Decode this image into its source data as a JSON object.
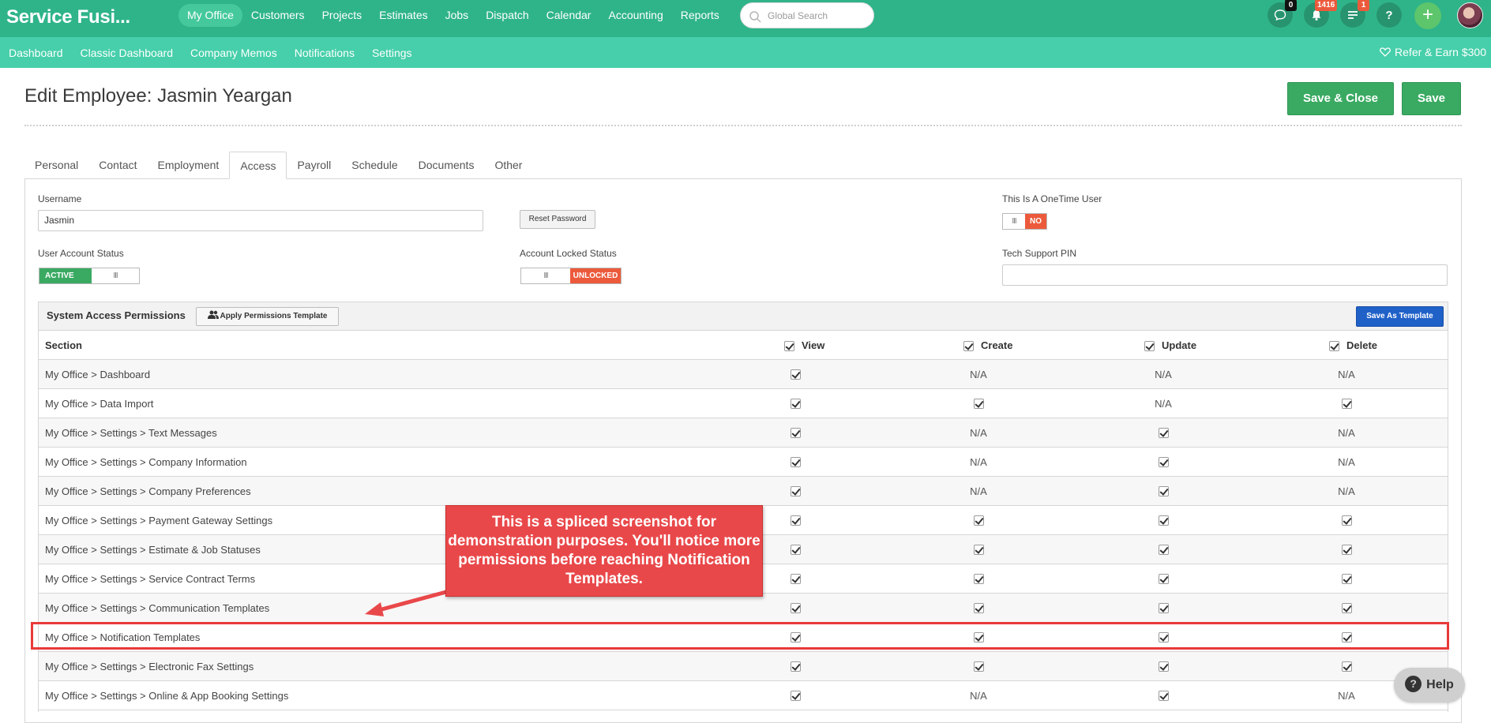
{
  "app": {
    "title": "Service Fusi..."
  },
  "main_nav": [
    "My Office",
    "Customers",
    "Projects",
    "Estimates",
    "Jobs",
    "Dispatch",
    "Calendar",
    "Accounting",
    "Reports"
  ],
  "search": {
    "placeholder": "Global Search"
  },
  "header_icons": {
    "chat_count": "0",
    "notification_count": "1416",
    "list_count": "1",
    "help_glyph": "?",
    "add_glyph": "+"
  },
  "sub_nav": [
    "Dashboard",
    "Classic Dashboard",
    "Company Memos",
    "Notifications",
    "Settings"
  ],
  "refer": {
    "label": "Refer & Earn $300"
  },
  "page": {
    "title": "Edit Employee: Jasmin Yeargan",
    "save_close_label": "Save & Close",
    "save_label": "Save"
  },
  "tabs": [
    "Personal",
    "Contact",
    "Employment",
    "Access",
    "Payroll",
    "Schedule",
    "Documents",
    "Other"
  ],
  "access": {
    "username_label": "Username",
    "username_value": "Jasmin",
    "reset_password_label": "Reset Password",
    "onetime_label": "This Is A OneTime User",
    "onetime_value": "NO",
    "account_status_label": "User Account Status",
    "account_status_value": "ACTIVE",
    "locked_label": "Account Locked Status",
    "locked_value": "UNLOCKED",
    "pin_label": "Tech Support PIN",
    "pin_value": "",
    "grip": "III"
  },
  "permissions": {
    "title": "System Access Permissions",
    "apply_template_label": "Apply Permissions Template",
    "save_template_label": "Save As Template",
    "columns": {
      "section": "Section",
      "view": "View",
      "create": "Create",
      "update": "Update",
      "delete": "Delete"
    },
    "na": "N/A",
    "rows": [
      {
        "section": "My Office > Dashboard",
        "view": "check",
        "create": "N/A",
        "update": "N/A",
        "delete": "N/A"
      },
      {
        "section": "My Office > Data Import",
        "view": "check",
        "create": "check",
        "update": "N/A",
        "delete": "check"
      },
      {
        "section": "My Office > Settings > Text Messages",
        "view": "check",
        "create": "N/A",
        "update": "check",
        "delete": "N/A"
      },
      {
        "section": "My Office > Settings > Company Information",
        "view": "check",
        "create": "N/A",
        "update": "check",
        "delete": "N/A"
      },
      {
        "section": "My Office > Settings > Company Preferences",
        "view": "check",
        "create": "N/A",
        "update": "check",
        "delete": "N/A"
      },
      {
        "section": "My Office > Settings > Payment Gateway Settings",
        "view": "check",
        "create": "check",
        "update": "check",
        "delete": "check"
      },
      {
        "section": "My Office > Settings > Estimate & Job Statuses",
        "view": "check",
        "create": "check",
        "update": "check",
        "delete": "check"
      },
      {
        "section": "My Office > Settings > Service Contract Terms",
        "view": "check",
        "create": "check",
        "update": "check",
        "delete": "check"
      },
      {
        "section": "My Office > Settings > Communication Templates",
        "view": "check",
        "create": "check",
        "update": "check",
        "delete": "check"
      },
      {
        "section": "My Office > Notification Templates",
        "view": "check",
        "create": "check",
        "update": "check",
        "delete": "check"
      },
      {
        "section": "My Office > Settings > Electronic Fax Settings",
        "view": "check",
        "create": "check",
        "update": "check",
        "delete": "check"
      },
      {
        "section": "My Office > Settings > Online & App Booking Settings",
        "view": "check",
        "create": "N/A",
        "update": "check",
        "delete": "N/A"
      }
    ]
  },
  "callout": {
    "text": "This is a spliced screenshot for demonstration purposes. You'll notice more permissions before reaching Notification Templates."
  },
  "help": {
    "label": "Help"
  },
  "colors": {
    "topbar": "#2fb489",
    "subbar": "#46cfaa",
    "save_green": "#3aaa62",
    "highlight_red": "#e83a3a",
    "callout_red": "#e9484a",
    "template_blue": "#2061c8"
  }
}
